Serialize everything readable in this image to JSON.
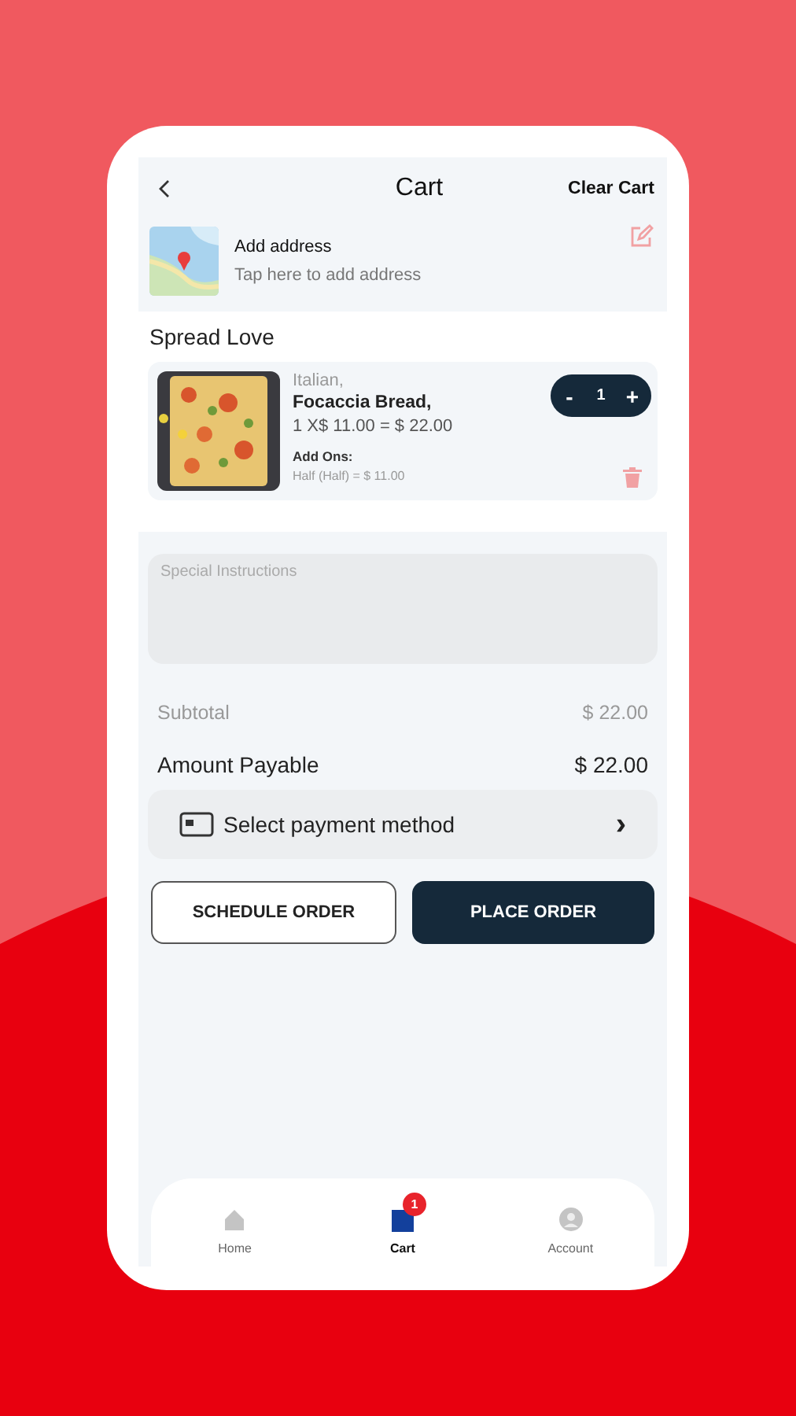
{
  "header": {
    "title": "Cart",
    "action": "Clear Cart"
  },
  "address": {
    "title": "Add address",
    "hint": "Tap here to add address"
  },
  "restaurant": "Spread Love",
  "items": [
    {
      "category": "Italian,",
      "name": "Focaccia Bread,",
      "price_line": "1 X$ 11.00 = $ 22.00",
      "addons_label": "Add Ons:",
      "addons": "Half (Half) = $ 11.00",
      "quantity": "1",
      "minus": "-",
      "plus": "+"
    }
  ],
  "instructions": {
    "placeholder": "Special Instructions"
  },
  "totals": [
    {
      "label": "Subtotal",
      "value": "$ 22.00",
      "kind": "muted"
    },
    {
      "label": "Amount Payable",
      "value": "$ 22.00",
      "kind": "strong"
    }
  ],
  "payment": {
    "label": "Select payment method",
    "arrow": "›"
  },
  "buttons": [
    {
      "label": "SCHEDULE ORDER",
      "kind": "outline"
    },
    {
      "label": "PLACE ORDER",
      "kind": "filled"
    }
  ],
  "nav": [
    {
      "label": "Home",
      "selected": false
    },
    {
      "label": "Cart",
      "selected": true,
      "badge": "1"
    },
    {
      "label": "Account",
      "selected": false
    }
  ]
}
